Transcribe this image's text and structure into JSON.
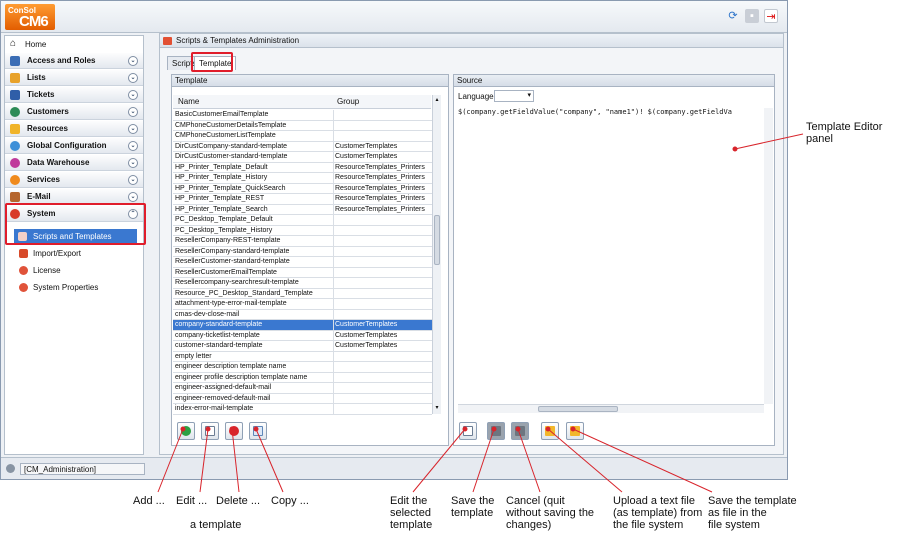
{
  "colors": {
    "accent": "#3a78d0",
    "highlight": "#e01d2b",
    "logo": "#f07a10"
  },
  "app": {
    "logo_line1": "ConSol",
    "logo_line2": "CM6"
  },
  "toolbar": {
    "refresh_icon": "refresh-icon",
    "logout_icon": "logout-icon"
  },
  "sidebar": {
    "home": "Home",
    "groups": [
      {
        "label": "Access and Roles",
        "icon": "roles-icon"
      },
      {
        "label": "Lists",
        "icon": "list-icon"
      },
      {
        "label": "Tickets",
        "icon": "ticket-icon"
      },
      {
        "label": "Customers",
        "icon": "customer-icon"
      },
      {
        "label": "Resources",
        "icon": "resource-icon"
      },
      {
        "label": "Global Configuration",
        "icon": "globe-icon"
      },
      {
        "label": "Data Warehouse",
        "icon": "warehouse-icon"
      },
      {
        "label": "Services",
        "icon": "services-icon"
      },
      {
        "label": "E-Mail",
        "icon": "mail-icon"
      },
      {
        "label": "System",
        "icon": "gear-icon"
      }
    ],
    "system_items": [
      "Scripts and Templates",
      "Import/Export",
      "License",
      "System Properties"
    ]
  },
  "panel": {
    "title": "Scripts & Templates Administration",
    "tabs": [
      "Scripts",
      "Template"
    ],
    "template_box": "Template",
    "columns": [
      "Name",
      "Group"
    ],
    "rows": [
      [
        "BasicCustomerEmailTemplate",
        ""
      ],
      [
        "CMPhoneCustomerDetailsTemplate",
        ""
      ],
      [
        "CMPhoneCustomerListTemplate",
        ""
      ],
      [
        "DirCustCompany-standard-template",
        "CustomerTemplates"
      ],
      [
        "DirCustCustomer-standard-template",
        "CustomerTemplates"
      ],
      [
        "HP_Printer_Template_Default",
        "ResourceTemplates_Printers"
      ],
      [
        "HP_Printer_Template_History",
        "ResourceTemplates_Printers"
      ],
      [
        "HP_Printer_Template_QuickSearch",
        "ResourceTemplates_Printers"
      ],
      [
        "HP_Printer_Template_REST",
        "ResourceTemplates_Printers"
      ],
      [
        "HP_Printer_Template_Search",
        "ResourceTemplates_Printers"
      ],
      [
        "PC_Desktop_Template_Default",
        ""
      ],
      [
        "PC_Desktop_Template_History",
        ""
      ],
      [
        "ResellerCompany-REST-template",
        ""
      ],
      [
        "ResellerCompany-standard-template",
        ""
      ],
      [
        "ResellerCustomer-standard-template",
        ""
      ],
      [
        "ResellerCustomerEmailTemplate",
        ""
      ],
      [
        "Resellercompany-searchresult-template",
        ""
      ],
      [
        "Resource_PC_Desktop_Standard_Template",
        ""
      ],
      [
        "attachment-type-error-mail-template",
        ""
      ],
      [
        "cmas-dev-close-mail",
        ""
      ],
      [
        "company-standard-template",
        "CustomerTemplates"
      ],
      [
        "company-ticketlist-template",
        "CustomerTemplates"
      ],
      [
        "customer-standard-template",
        "CustomerTemplates"
      ],
      [
        "empty letter",
        ""
      ],
      [
        "engineer description template name",
        ""
      ],
      [
        "engineer profile description template name",
        ""
      ],
      [
        "engineer-assigned-default-mail",
        ""
      ],
      [
        "engineer-removed-default-mail",
        ""
      ],
      [
        "index-error-mail-template",
        ""
      ]
    ],
    "selected_row": 20,
    "source_box": "Source",
    "language_label": "Language",
    "source_code": "$(company.getFieldValue(\"company\", \"name1\")! $(company.getFieldVa"
  },
  "status": {
    "user": "[CM_Administration]"
  },
  "annotations": {
    "editor_panel_l1": "Template Editor",
    "editor_panel_l2": "panel",
    "add": "Add ...",
    "edit": "Edit ...",
    "delete": "Delete ...",
    "copy": "Copy ...",
    "a_template": "a template",
    "edit_sel": [
      "Edit the",
      "selected",
      "template"
    ],
    "save": [
      "Save the",
      "template"
    ],
    "cancel": [
      "Cancel (quit",
      "without saving the",
      "changes)"
    ],
    "upload": [
      "Upload a text file",
      "(as template) from",
      "the file system"
    ],
    "savefile": [
      "Save the template",
      "as file in the",
      "file system"
    ]
  }
}
